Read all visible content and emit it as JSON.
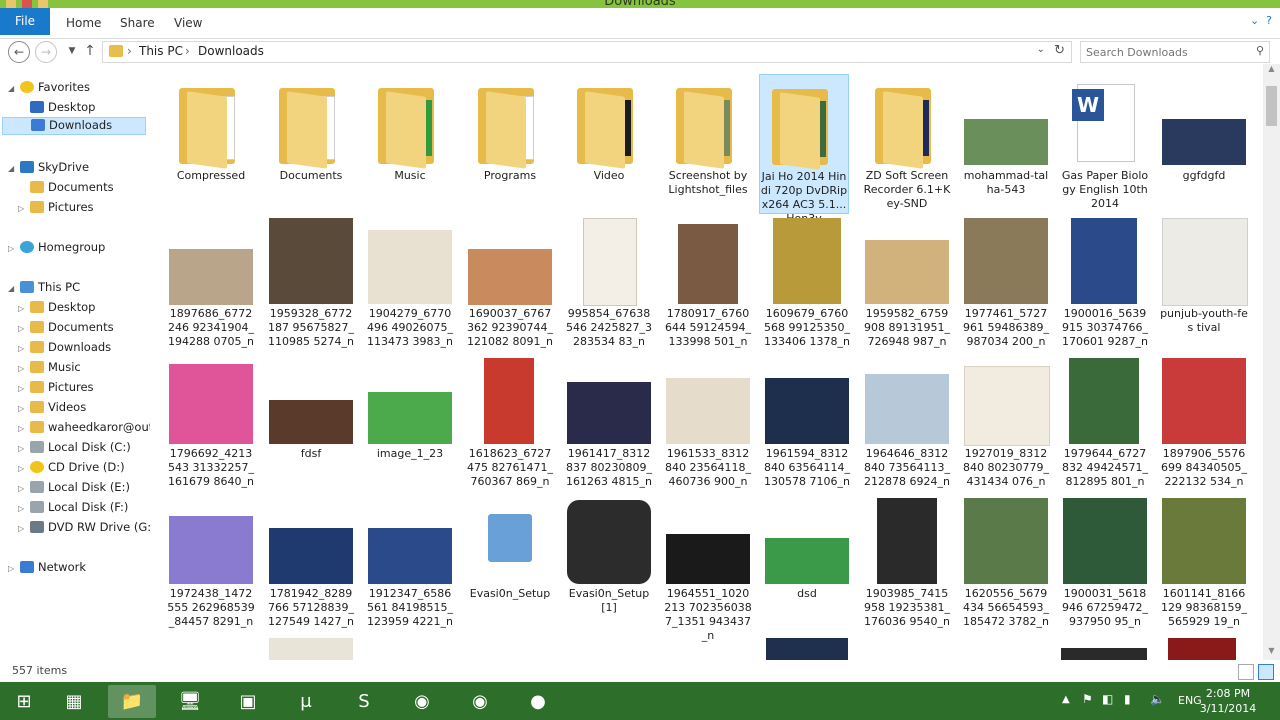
{
  "window": {
    "title": "Downloads"
  },
  "ribbon": {
    "tabs": [
      "File",
      "Home",
      "Share",
      "View"
    ]
  },
  "address": {
    "crumbs": [
      "This PC",
      "Downloads"
    ],
    "search_placeholder": "Search Downloads"
  },
  "nav": {
    "groups": [
      {
        "label": "Favorites",
        "children": [
          "Desktop",
          "Downloads"
        ]
      },
      {
        "label": "SkyDrive",
        "children": [
          "Documents",
          "Pictures"
        ]
      },
      {
        "label": "Homegroup",
        "children": []
      },
      {
        "label": "This PC",
        "children": [
          "Desktop",
          "Documents",
          "Downloads",
          "Music",
          "Pictures",
          "Videos",
          "waheedkaror@outlo",
          "Local Disk (C:)",
          "CD Drive (D:)",
          "Local Disk (E:)",
          "Local Disk (F:)",
          "DVD RW Drive (G:) C"
        ]
      },
      {
        "label": "Network",
        "children": []
      }
    ]
  },
  "files": {
    "row1": [
      {
        "name": "Compressed",
        "kind": "folder"
      },
      {
        "name": "Documents",
        "kind": "folder"
      },
      {
        "name": "Music",
        "kind": "folder"
      },
      {
        "name": "Programs",
        "kind": "folder"
      },
      {
        "name": "Video",
        "kind": "folder"
      },
      {
        "name": "Screenshot by Lightshot_files",
        "kind": "folder"
      },
      {
        "name": "Jai Ho 2014 Hindi 720p DvDRip x264 AC3 5.1...Hon3y",
        "kind": "folder"
      },
      {
        "name": "ZD Soft Screen Recorder 6.1+Key-SND",
        "kind": "folder"
      },
      {
        "name": "mohammad-talha-543",
        "kind": "image"
      },
      {
        "name": "Gas Paper Biology English 10th 2014",
        "kind": "word"
      },
      {
        "name": "ggfdgfd",
        "kind": "image"
      }
    ],
    "row2": [
      "1897686_6772246 92341904_194288 0705_n",
      "1959328_6772187 95675827_110985 5274_n",
      "1904279_6770496 49026075_113473 3983_n",
      "1690037_6767362 92390744_121082 8091_n",
      "995854_67638546 2425827_3283534 83_n",
      "1780917_6760644 59124594_133998 501_n",
      "1609679_6760568 99125350_133406 1378_n",
      "1959582_6759908 89131951_726948 987_n",
      "1977461_5727961 59486389_987034 200_n",
      "1900016_5639915 30374766_170601 9287_n",
      "punjub-youth-fes tival"
    ],
    "row3": [
      "1796692_4213543 31332257_161679 8640_n",
      "fdsf",
      "image_1_23",
      "1618623_6727475 82761471_760367 869_n",
      "1961417_8312837 80230809_161263 4815_n",
      "1961533_8312840 23564118_460736 900_n",
      "1961594_8312840 63564114_130578 7106_n",
      "1964646_8312840 73564113_212878 6924_n",
      "1927019_8312840 80230779_431434 076_n",
      "1979644_6727832 49424571_812895 801_n",
      "1897906_5576699 84340505_222132 534_n"
    ],
    "row4": [
      "1972438_1472555 262968539_84457 8291_n",
      "1781942_8289766 57128839_127549 1427_n",
      "1912347_6586561 84198515_123959 4221_n",
      "Evasi0n_Setup",
      "Evasi0n_Setup [1]",
      "1964551_1020213 7023560387_1351 943437_n",
      "dsd",
      "1903985_7415958 19235381_176036 9540_n",
      "1620556_5679434 56654593_185472 3782_n",
      "1900031_5618946 67259472_937950 95_n",
      "1601141_8166129 98368159_565929 19_n"
    ]
  },
  "status": {
    "item_count": "557 items"
  },
  "taskbar": {
    "lang": "ENG",
    "time": "2:08 PM",
    "date": "3/11/2014"
  }
}
